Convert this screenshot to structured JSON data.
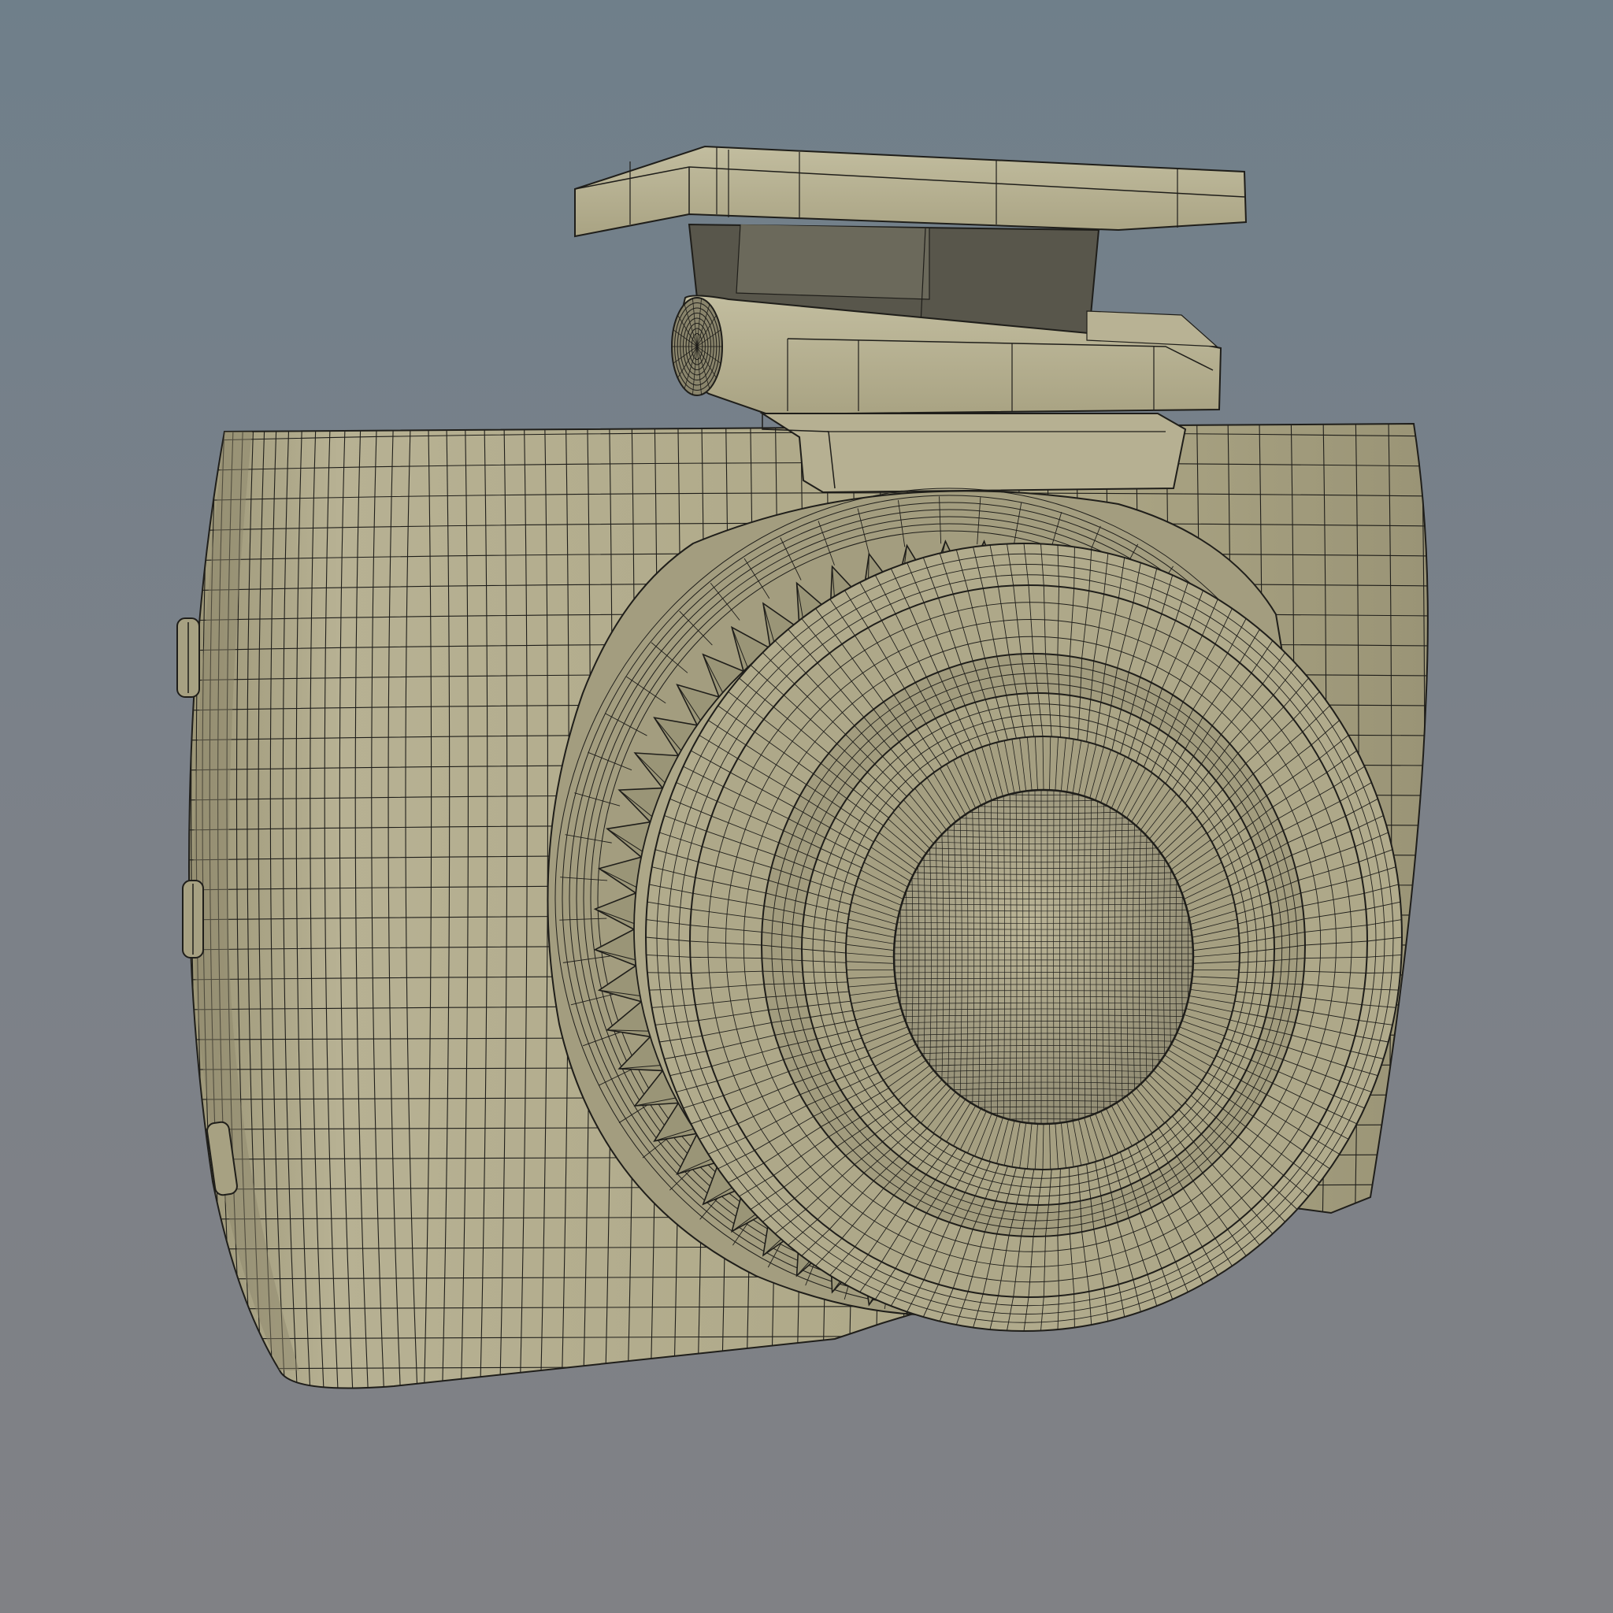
{
  "viewport": {
    "background_top": "#6f7f8a",
    "background_bottom": "#808185"
  },
  "model": {
    "subject": "camera-wireframe-model",
    "surface_color": "#b3ad8c",
    "surface_shadow": "#8f8a6f",
    "wire_color": "#1f1e1a",
    "parts": [
      "body",
      "hot-shoe-mount",
      "knurled-lens-ring",
      "lens-barrel",
      "lens-glass",
      "side-buttons"
    ]
  }
}
